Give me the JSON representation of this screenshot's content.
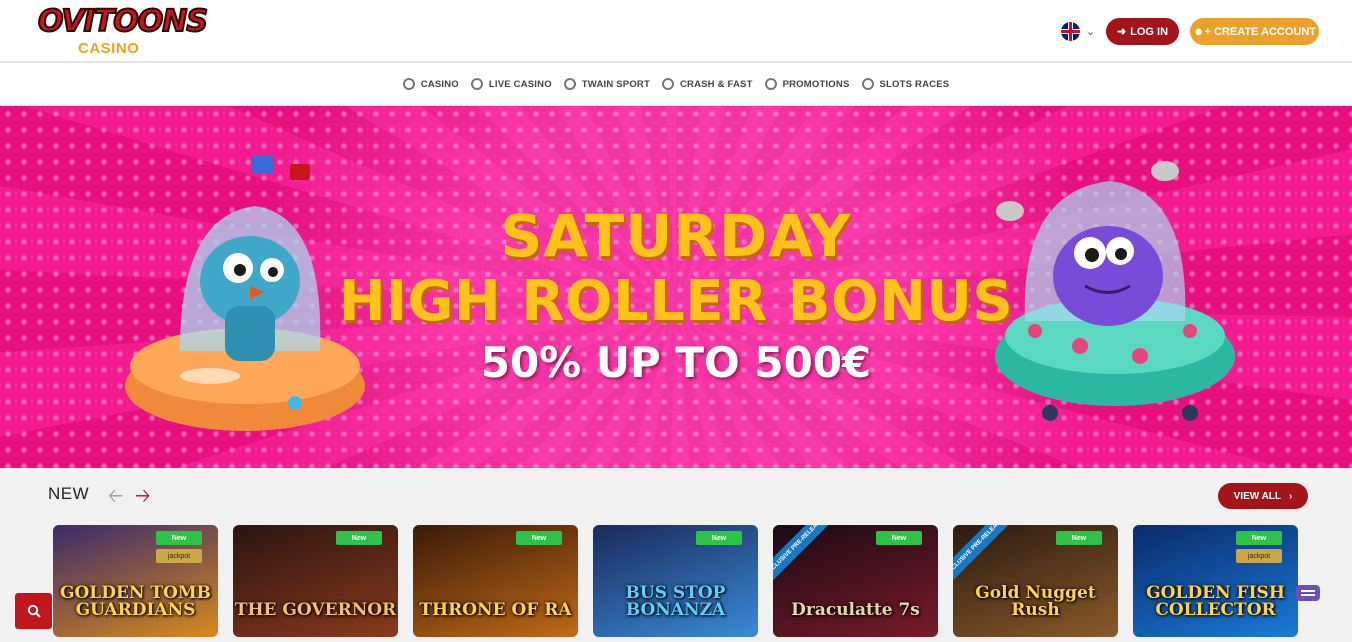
{
  "header": {
    "logo_text": "OVITOONS",
    "logo_sub": "CASINO",
    "login_label": "LOG IN",
    "create_label": "CREATE ACCOUNT"
  },
  "nav": {
    "items": [
      {
        "label": "CASINO"
      },
      {
        "label": "LIVE CASINO"
      },
      {
        "label": "TWAIN SPORT"
      },
      {
        "label": "CRASH & FAST"
      },
      {
        "label": "PROMOTIONS"
      },
      {
        "label": "SLOTS RACES"
      }
    ]
  },
  "banner": {
    "line1": "SATURDAY",
    "line2": "HIGH ROLLER BONUS",
    "line3": "50% UP TO 500€"
  },
  "section": {
    "title": "NEW",
    "view_all": "VIEW ALL"
  },
  "games": [
    {
      "title": "GOLDEN TOMB GUARDIANS",
      "badge": "New",
      "jackpot": "jackpot",
      "bg1": "#3a2a6a",
      "bg2": "#d98a1c",
      "color": "#ffd34a"
    },
    {
      "title": "THE GOVERNOR",
      "badge": "New",
      "bg1": "#2a1410",
      "bg2": "#8a3a1c",
      "color": "#f0c26a"
    },
    {
      "title": "THRONE OF RA",
      "badge": "New",
      "bg1": "#3a1a08",
      "bg2": "#c06a18",
      "color": "#ffd34a"
    },
    {
      "title": "BUS STOP BONANZA",
      "badge": "New",
      "bg1": "#1a2a5a",
      "bg2": "#3a8ad8",
      "color": "#5ad0ff"
    },
    {
      "title": "Draculatte 7s",
      "badge": "New",
      "exclusive": "EXCLUSIVE PRE-RELEASE",
      "bg1": "#1a0a14",
      "bg2": "#7a1a2a",
      "color": "#e8d6b0"
    },
    {
      "title": "Gold Nugget Rush",
      "badge": "New",
      "exclusive": "EXCLUSIVE PRE-RELEASE",
      "bg1": "#2a1a10",
      "bg2": "#8a5a2a",
      "color": "#ffd34a"
    },
    {
      "title": "GOLDEN FISH COLLECTOR",
      "badge": "New",
      "jackpot": "jackpot",
      "bg1": "#0a2a6a",
      "bg2": "#1a7ad8",
      "color": "#ffd34a"
    }
  ]
}
